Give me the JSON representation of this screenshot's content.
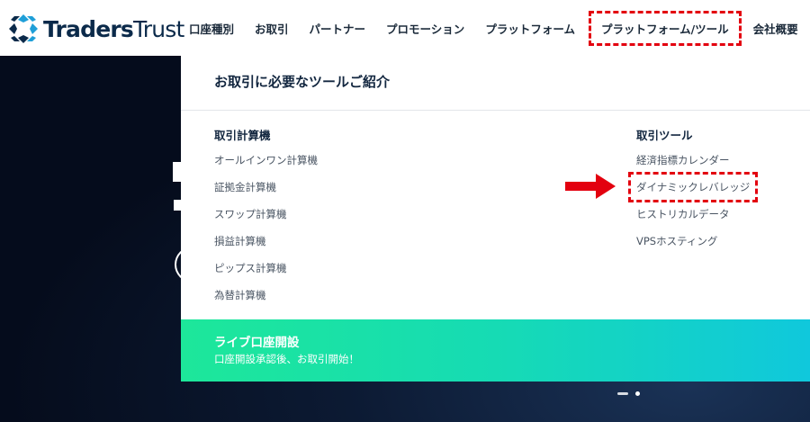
{
  "logo": {
    "brand_bold": "Traders",
    "brand_light": "Trust"
  },
  "nav": {
    "items": [
      {
        "label": "口座種別"
      },
      {
        "label": "お取引"
      },
      {
        "label": "パートナー"
      },
      {
        "label": "プロモーション"
      },
      {
        "label": "プラットフォーム"
      },
      {
        "label": "プラットフォーム/ツール",
        "active": true
      },
      {
        "label": "会社概要"
      }
    ]
  },
  "mega": {
    "title": "お取引に必要なツールご紹介",
    "left": {
      "heading": "取引計算機",
      "links": [
        "オールインワン計算機",
        "証拠金計算機",
        "スワップ計算機",
        "損益計算機",
        "ピップス計算機",
        "為替計算機"
      ]
    },
    "right": {
      "heading": "取引ツール",
      "links": [
        "経済指標カレンダー",
        "ダイナミックレバレッジ",
        "ヒストリカルデータ",
        "VPSホスティング"
      ]
    },
    "cta": {
      "title": "ライブ口座開設",
      "subtitle": "口座開設承認後、お取引開始！"
    }
  },
  "colors": {
    "highlight": "#e3000f",
    "cta_start": "#1de79a",
    "cta_end": "#10c8dc",
    "hero_bg": "#050c1c"
  },
  "icons": {
    "logo": "traders-trust-logo-icon",
    "arrow": "red-arrow-icon"
  }
}
